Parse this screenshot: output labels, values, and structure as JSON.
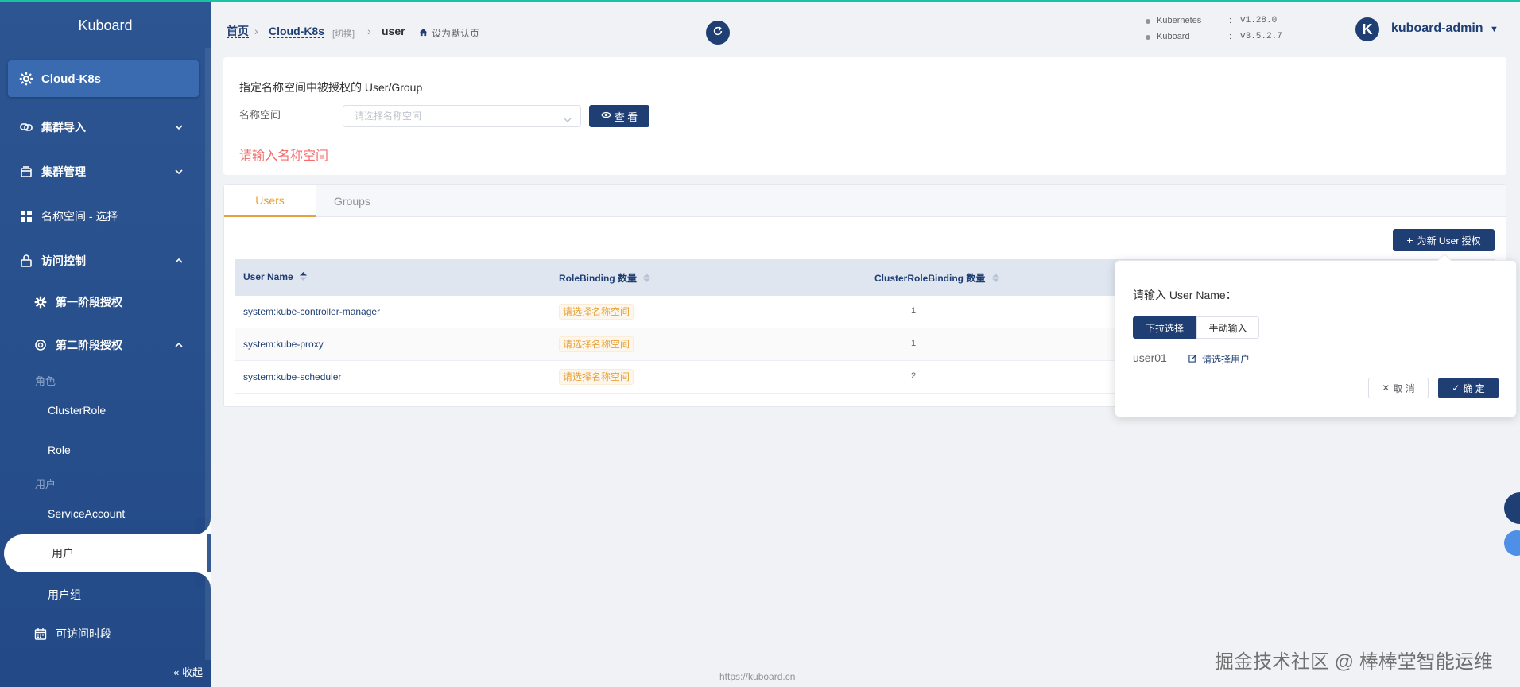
{
  "sidebar": {
    "app_title": "Kuboard",
    "cluster": "Cloud-K8s",
    "items": [
      {
        "label": "集群导入"
      },
      {
        "label": "集群管理"
      },
      {
        "label": "名称空间 - 选择"
      },
      {
        "label": "访问控制"
      },
      {
        "label": "第一阶段授权"
      },
      {
        "label": "第二阶段授权"
      }
    ],
    "group_role": "角色",
    "cluster_role": "ClusterRole",
    "role": "Role",
    "group_user": "用户",
    "service_account": "ServiceAccount",
    "users": "用户",
    "user_groups": "用户组",
    "access_time": "可访问时段",
    "collapse": "收起"
  },
  "header": {
    "home": "首页",
    "cluster": "Cloud-K8s",
    "switch": "[切换]",
    "current": "user",
    "set_default": "设为默认页",
    "kubernetes_label": "Kubernetes",
    "kubernetes_version": "v1.28.0",
    "kuboard_label": "Kuboard",
    "kuboard_version": "v3.5.2.7",
    "version_sep": ":",
    "avatar_letter": "K",
    "user": "kuboard-admin"
  },
  "filter": {
    "title": "指定名称空间中被授权的 User/Group",
    "namespace_label": "名称空间",
    "namespace_placeholder": "请选择名称空间",
    "view_button": "查 看",
    "error": "请输入名称空间"
  },
  "tabs": [
    {
      "label": "Users"
    },
    {
      "label": "Groups"
    }
  ],
  "table": {
    "add_button": "为新 User 授权",
    "columns": [
      "User Name",
      "RoleBinding 数量",
      "ClusterRoleBinding 数量"
    ],
    "rows": [
      {
        "name": "system:kube-controller-manager",
        "rolebinding": "请选择名称空间",
        "clusterrolebinding": "1"
      },
      {
        "name": "system:kube-proxy",
        "rolebinding": "请选择名称空间",
        "clusterrolebinding": "1"
      },
      {
        "name": "system:kube-scheduler",
        "rolebinding": "请选择名称空间",
        "clusterrolebinding": "2"
      }
    ]
  },
  "popover": {
    "title": "请输入 User Name：",
    "mode_dropdown": "下拉选择",
    "mode_manual": "手动输入",
    "user_value": "user01",
    "select_user": "请选择用户",
    "cancel": "取 消",
    "confirm": "确 定"
  },
  "footer": "https://kuboard.cn",
  "watermark": "掘金技术社区 @ 棒棒堂智能运维",
  "colors": {
    "primary": "#1f3f74",
    "sidebar": "#2c5591",
    "warning": "#e6a23c",
    "danger": "#f56c6c",
    "accent_line": "#17c3a3"
  }
}
